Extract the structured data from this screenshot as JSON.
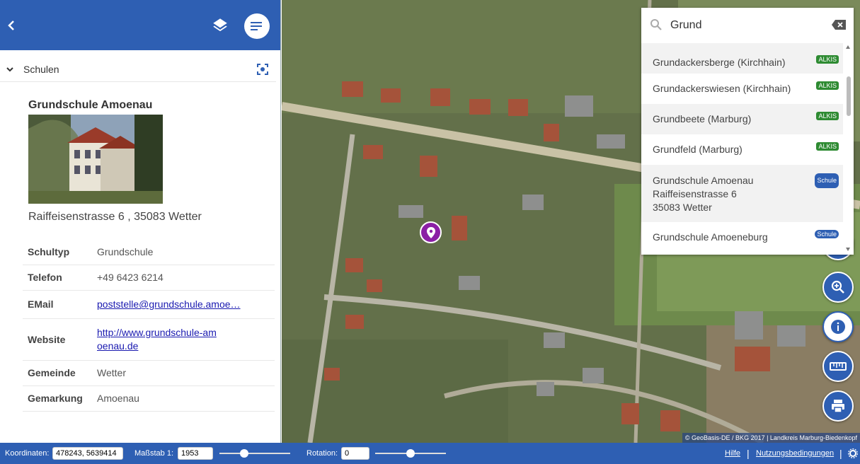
{
  "panel": {
    "section_title": "Schulen",
    "poi": {
      "title": "Grundschule Amoenau",
      "address": "Raiffeisenstrasse 6 , 35083 Wetter",
      "attributes": [
        {
          "key": "Schultyp",
          "value": "Grundschule"
        },
        {
          "key": "Telefon",
          "value": "+49 6423 6214"
        },
        {
          "key": "EMail",
          "value": "poststelle@grundschule.amoe…"
        },
        {
          "key": "Website",
          "value": "http://www.grundschule-amoenau.de"
        },
        {
          "key": "Gemeinde",
          "value": "Wetter"
        },
        {
          "key": "Gemarkung",
          "value": "Amoenau"
        }
      ]
    }
  },
  "search": {
    "query": "Grund",
    "results": [
      {
        "l1": "Grundackersberge (Kirchhain)",
        "badge": "ALKIS"
      },
      {
        "l1": "Grundackerswiesen (Kirchhain)",
        "badge": "ALKIS"
      },
      {
        "l1": "Grundbeete (Marburg)",
        "badge": "ALKIS"
      },
      {
        "l1": "Grundfeld (Marburg)",
        "badge": "ALKIS"
      },
      {
        "l1": "Grundschule Amoenau",
        "l2": "Raiffeisenstrasse 6",
        "l3": "35083 Wetter",
        "badge": "Schule"
      },
      {
        "l1": "Grundschule Amoeneburg",
        "badge": "Schule"
      }
    ]
  },
  "map": {
    "attribution": "© GeoBasis-DE / BKG 2017 | Landkreis Marburg-Biedenkopf"
  },
  "footer": {
    "coord_label": "Koordinaten:",
    "coord_value": "478243, 5639414",
    "scale_label": "Maßstab 1:",
    "scale_value": "1953",
    "rotation_label": "Rotation:",
    "rotation_value": "0",
    "help_link": "Hilfe",
    "terms_link": "Nutzungsbedingungen"
  },
  "colors": {
    "primary": "#2e5fb3",
    "alkis": "#2e8b32",
    "marker": "#8b1fa5"
  }
}
